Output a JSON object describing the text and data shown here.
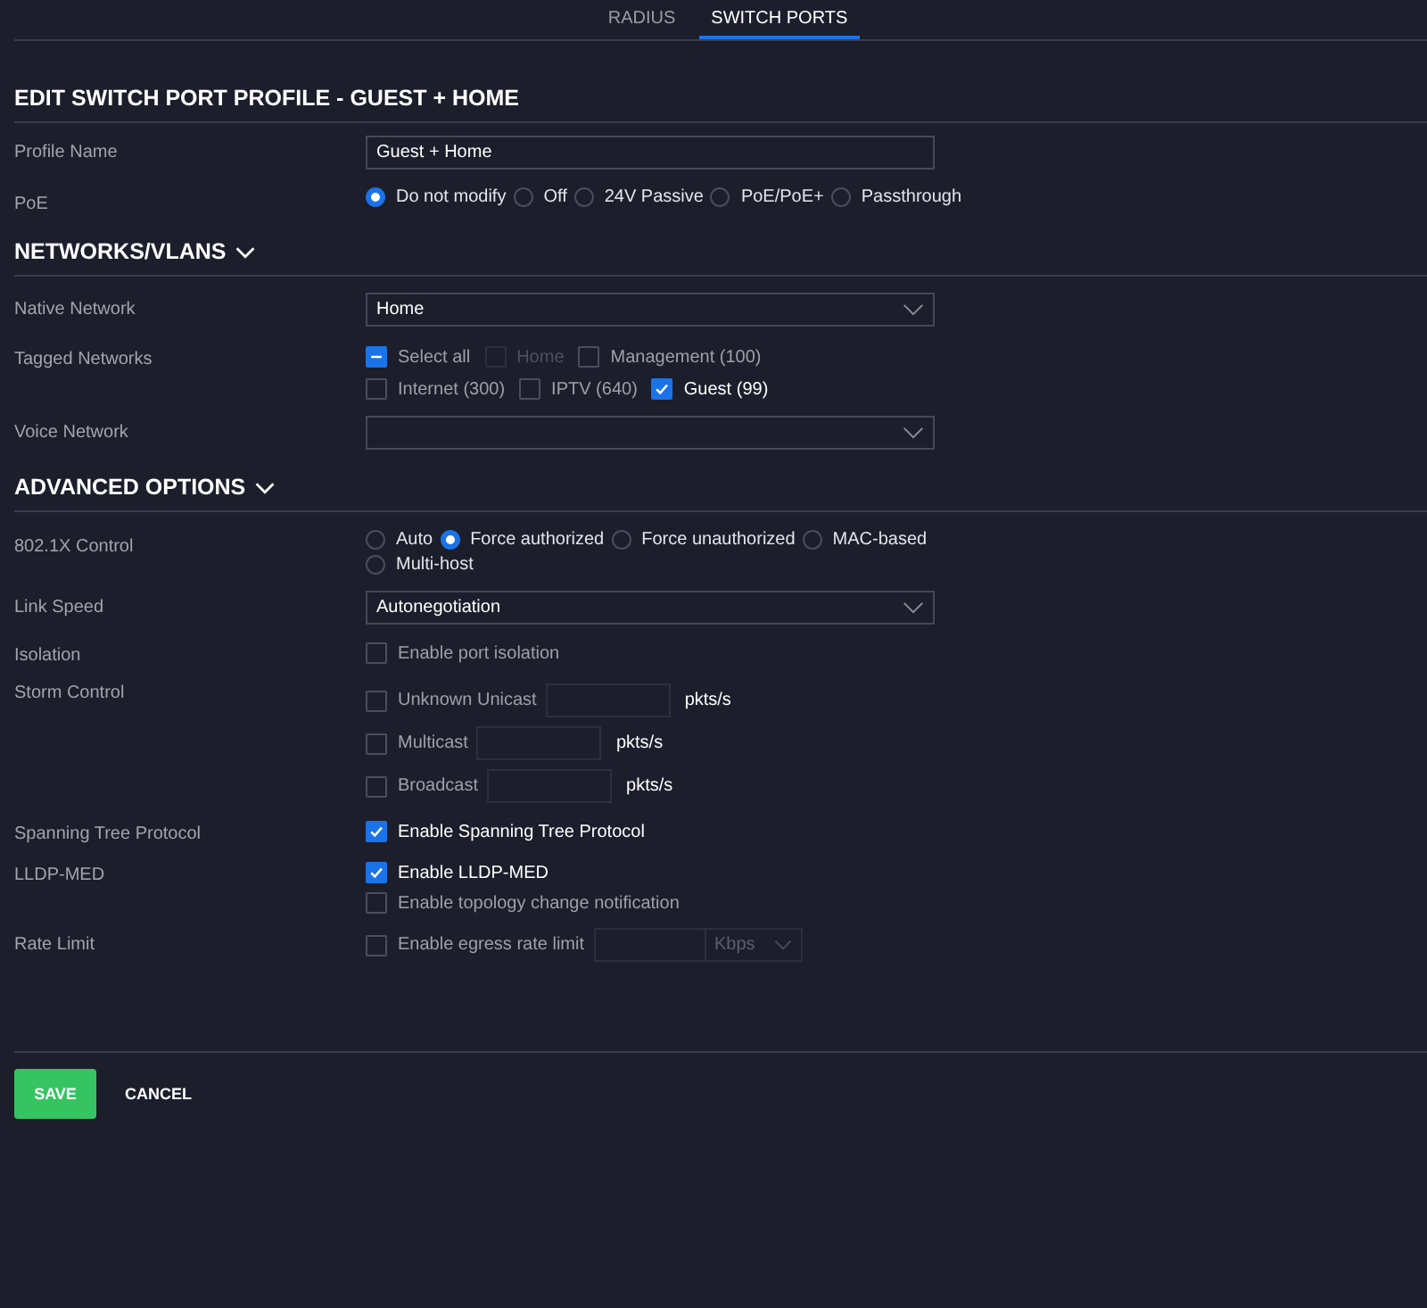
{
  "tabs": [
    {
      "label": "RADIUS",
      "selected": false
    },
    {
      "label": "SWITCH PORTS",
      "selected": true
    }
  ],
  "title": "EDIT SWITCH PORT PROFILE - GUEST + HOME",
  "sections": [
    {
      "rows": [
        {
          "label": "Profile Name",
          "kind": "text",
          "value": "Guest + Home"
        },
        {
          "label": "PoE",
          "kind": "radios",
          "options": [
            {
              "label": "Do not modify",
              "selected": true
            },
            {
              "label": "Off",
              "selected": false
            },
            {
              "label": "24V Passive",
              "selected": false
            },
            {
              "label": "PoE/PoE+",
              "selected": false
            },
            {
              "label": "Passthrough",
              "selected": false
            }
          ]
        }
      ]
    },
    {
      "heading": "NETWORKS/VLANS",
      "expanded": true,
      "rows": [
        {
          "label": "Native Network",
          "kind": "select",
          "value": "Home"
        },
        {
          "label": "Tagged Networks",
          "kind": "checkgrid",
          "items": [
            {
              "label": "Select all",
              "checked": false,
              "mixed": true,
              "disabled": false
            },
            {
              "label": "Home",
              "checked": false,
              "disabled": true
            },
            {
              "label": "Management (100)",
              "checked": false,
              "disabled": false
            },
            {
              "label": "Internet (300)",
              "checked": false,
              "disabled": false
            },
            {
              "label": "IPTV (640)",
              "checked": false,
              "disabled": false
            },
            {
              "label": "Guest (99)",
              "checked": true,
              "disabled": false
            }
          ]
        },
        {
          "label": "Voice Network",
          "kind": "select",
          "value": null
        }
      ]
    },
    {
      "heading": "ADVANCED OPTIONS",
      "expanded": true,
      "rows": [
        {
          "label": "802.1X Control",
          "kind": "radios",
          "options": [
            {
              "label": "Auto",
              "selected": false
            },
            {
              "label": "Force authorized",
              "selected": true
            },
            {
              "label": "Force unauthorized",
              "selected": false
            },
            {
              "label": "MAC-based",
              "selected": false
            },
            {
              "label": "Multi-host",
              "selected": false
            }
          ]
        },
        {
          "label": "Link Speed",
          "kind": "select",
          "value": "Autonegotiation"
        },
        {
          "label": "Isolation",
          "kind": "checklist",
          "items": [
            {
              "label": "Enable port isolation",
              "checked": false
            }
          ]
        },
        {
          "label": "Storm Control",
          "kind": "ratelist",
          "items": [
            {
              "label": "Unknown Unicast",
              "checked": false,
              "unit": "pkts/s"
            },
            {
              "label": "Multicast",
              "checked": false,
              "unit": "pkts/s"
            },
            {
              "label": "Broadcast",
              "checked": false,
              "unit": "pkts/s"
            }
          ]
        },
        {
          "label": "Spanning Tree Protocol",
          "kind": "checklist",
          "items": [
            {
              "label": "Enable Spanning Tree Protocol",
              "checked": true
            }
          ]
        },
        {
          "label": "LLDP-MED",
          "kind": "checklist",
          "items": [
            {
              "label": "Enable LLDP-MED",
              "checked": true
            },
            {
              "label": "Enable topology change notification",
              "checked": false
            }
          ]
        },
        {
          "label": "Rate Limit",
          "kind": "egress",
          "items": [
            {
              "label": "Enable egress rate limit",
              "checked": false,
              "unit": "Kbps"
            }
          ]
        }
      ]
    }
  ],
  "buttons": [
    {
      "label": "SAVE",
      "kind": "primary"
    },
    {
      "label": "CANCEL",
      "kind": "plain"
    }
  ]
}
